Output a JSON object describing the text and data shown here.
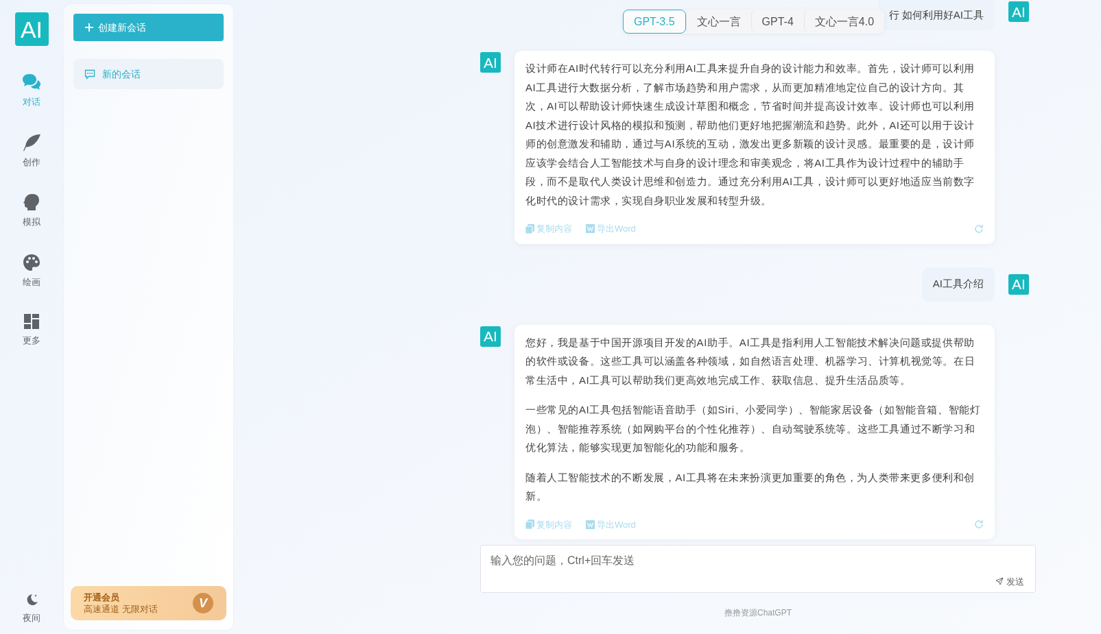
{
  "logo": {
    "text": "AI"
  },
  "nav": [
    {
      "label": "对话",
      "selected": true
    },
    {
      "label": "创作",
      "selected": false
    },
    {
      "label": "模拟",
      "selected": false
    },
    {
      "label": "绘画",
      "selected": false
    },
    {
      "label": "更多",
      "selected": false
    }
  ],
  "night_mode": {
    "label": "夜间"
  },
  "sidebar": {
    "new_chat_button": "创建新会话",
    "conversations": [
      {
        "title": "新的会话",
        "selected": true
      }
    ],
    "vip_card": {
      "title": "开通会员",
      "subtitle": "高速通道 无限对话",
      "badge": "V"
    }
  },
  "model_tabs": [
    {
      "label": "GPT-3.5",
      "selected": true
    },
    {
      "label": "文心一言",
      "selected": false
    },
    {
      "label": "GPT-4",
      "selected": false
    },
    {
      "label": "文心一言4.0",
      "selected": false
    }
  ],
  "messages": [
    {
      "kind": "user",
      "avatar": "AI",
      "paragraphs": [
        "行 如何利用好AI工具"
      ]
    },
    {
      "kind": "assistant",
      "avatar": "AI",
      "paragraphs": [
        "设计师在AI时代转行可以充分利用AI工具来提升自身的设计能力和效率。首先，设计师可以利用AI工具进行大数据分析，了解市场趋势和用户需求，从而更加精准地定位自己的设计方向。其次，AI可以帮助设计师快速生成设计草图和概念，节省时间并提高设计效率。设计师也可以利用AI技术进行设计风格的模拟和预测，帮助他们更好地把握潮流和趋势。此外，AI还可以用于设计师的创意激发和辅助，通过与AI系统的互动，激发出更多新颖的设计灵感。最重要的是，设计师应该学会结合人工智能技术与自身的设计理念和审美观念，将AI工具作为设计过程中的辅助手段，而不是取代人类设计思维和创造力。通过充分利用AI工具，设计师可以更好地适应当前数字化时代的设计需求，实现自身职业发展和转型升级。"
      ],
      "copy_label": "复制内容",
      "export_label": "导出Word"
    },
    {
      "kind": "user",
      "avatar": "AI",
      "paragraphs": [
        "AI工具介绍"
      ]
    },
    {
      "kind": "assistant",
      "avatar": "AI",
      "paragraphs": [
        "您好，我是基于中国开源项目开发的AI助手。AI工具是指利用人工智能技术解决问题或提供帮助的软件或设备。这些工具可以涵盖各种领域，如自然语言处理、机器学习、计算机视觉等。在日常生活中，AI工具可以帮助我们更高效地完成工作、获取信息、提升生活品质等。",
        "一些常见的AI工具包括智能语音助手（如Siri、小爱同学）、智能家居设备（如智能音箱、智能灯泡）、智能推荐系统（如网购平台的个性化推荐）、自动驾驶系统等。这些工具通过不断学习和优化算法，能够实现更加智能化的功能和服务。",
        "随着人工智能技术的不断发展，AI工具将在未来扮演更加重要的角色，为人类带来更多便利和创新。"
      ],
      "copy_label": "复制内容",
      "export_label": "导出Word"
    }
  ],
  "input": {
    "placeholder": "输入您的问题，Ctrl+回车发送",
    "send_button": "发送"
  },
  "footer": "撸撸资源ChatGPT"
}
